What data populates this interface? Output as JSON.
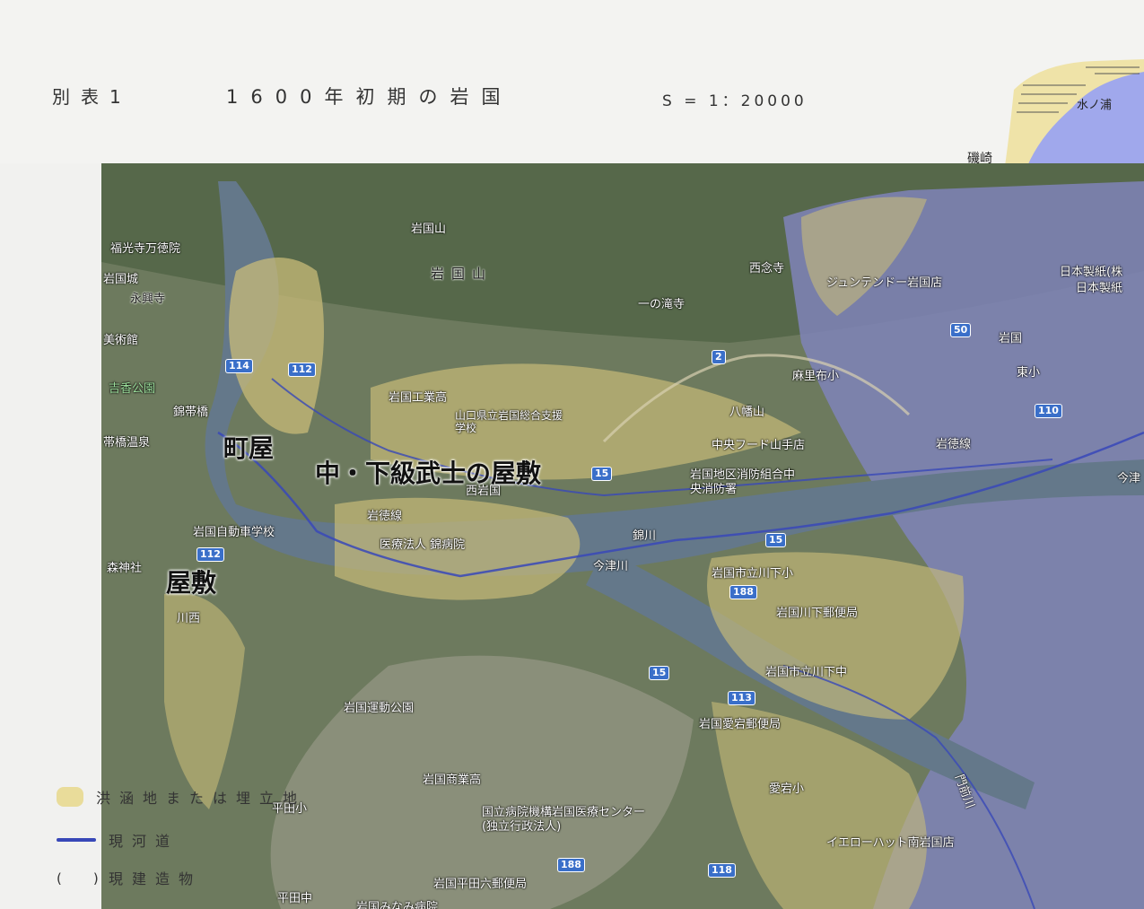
{
  "header": {
    "table_label": "別表1",
    "title": "1600年初期の岩国",
    "scale": "S = 1：20000"
  },
  "inset": {
    "bay_label": "水ノ浦",
    "cape_label": "磯崎"
  },
  "annotations": {
    "machiya": "町屋",
    "samurai": "中・下級武士の屋敷",
    "yashiki": "屋敷"
  },
  "map_labels": {
    "mt_iwakuni_poi": "岩国山",
    "mt_iwakuni": "岩国山",
    "fukukoji": "福光寺万徳院",
    "iwakuni_castle": "岩国城",
    "eikoji": "永興寺",
    "museum": "美術館",
    "kikko_park": "吉香公園",
    "kintaikyo": "錦帯橋",
    "kintaikyo_spa": "帯橋温泉",
    "nishinenji": "西念寺",
    "ichinotakidera": "一の滝寺",
    "junteendo": "ジュンテンドー岩国店",
    "nippon_seishi": "日本製紙(株",
    "nippon_seishi2": "日本製紙",
    "iwakuni_station": "岩国",
    "higashi_elem": "東小",
    "mariifu_elem": "麻里布小",
    "iwakuni_tech": "岩国工業高",
    "yamaguchi_school": "山口県立岩国総合支援学校",
    "hachimanyama": "八幡山",
    "chuo_food": "中央フード山手店",
    "fire_station": "岩国地区消防組合中央消防署",
    "nishi_iwakuni": "西岩国",
    "iwatoku_line_w": "岩徳線",
    "iwatoku_line_e": "岩徳線",
    "iwakuni_jidosha": "岩国自動車学校",
    "kinbyoin": "医療法人 錦病院",
    "morijinja": "森神社",
    "kawanishi": "川西",
    "imazu_river": "今津川",
    "tatekawa_shimo": "岩国市立川下小",
    "kawashimo_post": "岩国川下郵便局",
    "kawashimo_chu": "岩国市立川下中",
    "iwakuni_sports": "岩国運動公園",
    "atago_post": "岩国愛宕郵便局",
    "iwakuni_commercial": "岩国商業高",
    "atago_elem": "愛宕小",
    "hirata_elem": "平田小",
    "hospital": "国立病院機構岩国医療センター(独立行政法人)",
    "yellow_hat": "イエローハット南岩国店",
    "hirata_post": "岩国平田六郵便局",
    "hirata_chu": "平田中",
    "minami_hospital": "岩国みなみ病院",
    "monzen_river": "門前川",
    "imazu": "今津",
    "nishiki_river": "錦川"
  },
  "routes": [
    "114",
    "112",
    "2",
    "50",
    "110",
    "15",
    "15",
    "188",
    "15",
    "113",
    "188",
    "118",
    "112"
  ],
  "legend": {
    "flood_label": "洪涵地または埋立地",
    "river_label": "現河道",
    "building_symbol": "(　)",
    "building_label": "現建造物"
  },
  "colors": {
    "paper": "#f1f1ef",
    "flood_area": "#e9dc9a",
    "river_line": "#3848b8",
    "sea": "#9fa8e8"
  }
}
